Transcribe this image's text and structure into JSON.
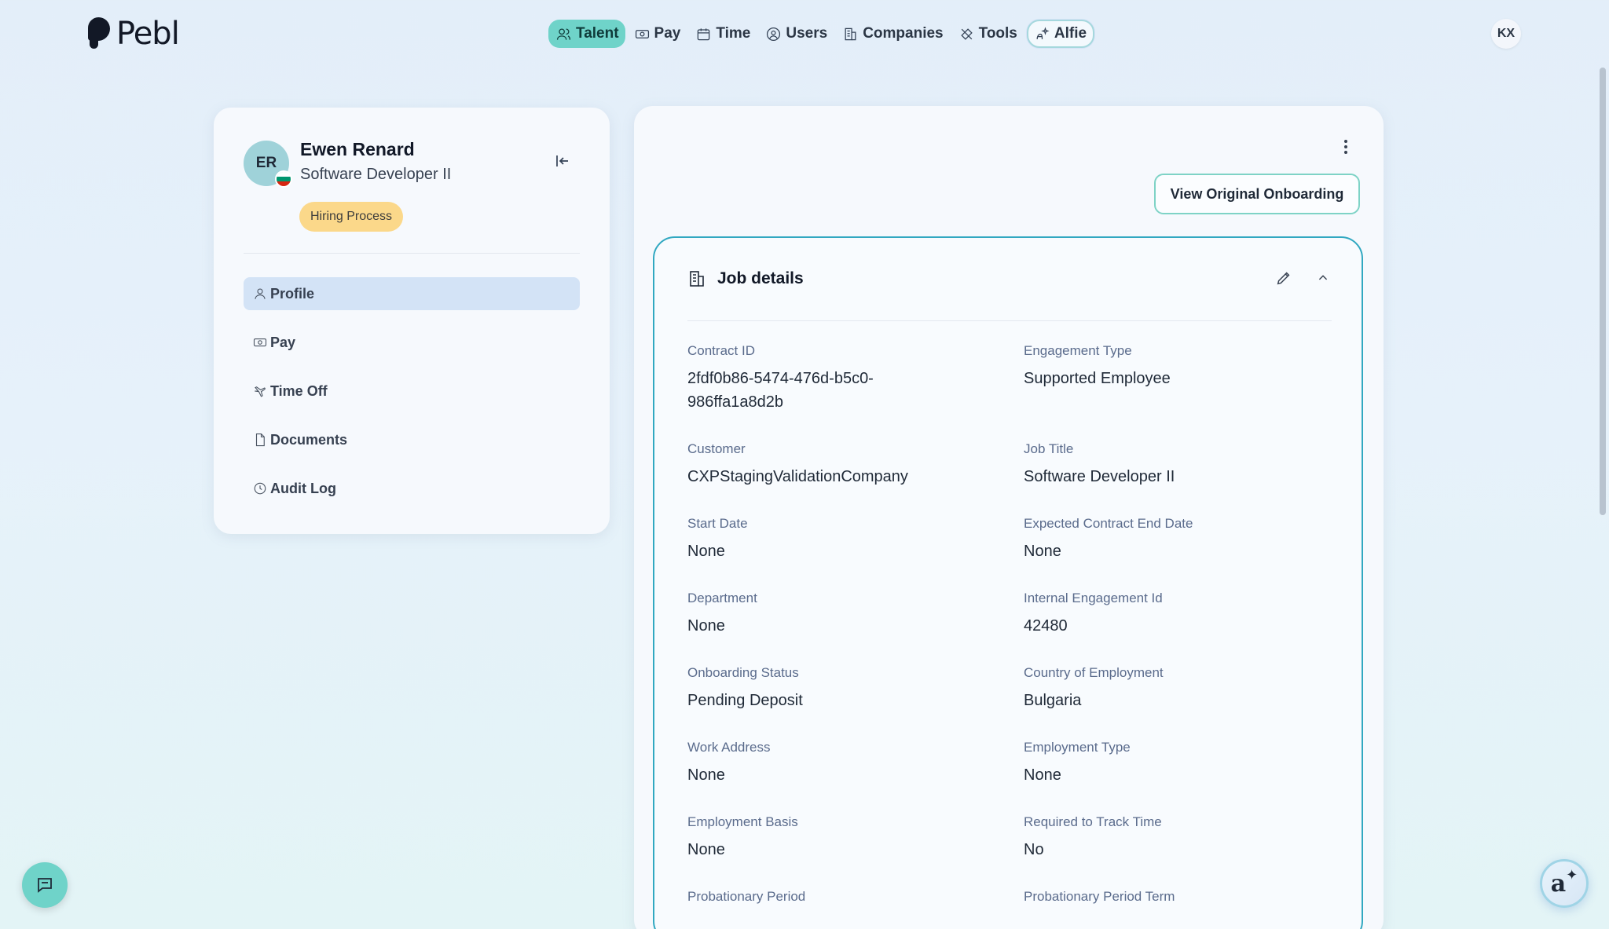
{
  "brand": {
    "name": "Pebl"
  },
  "nav": {
    "items": [
      {
        "label": "Talent",
        "icon": "users-icon",
        "active": true
      },
      {
        "label": "Pay",
        "icon": "money-icon"
      },
      {
        "label": "Time",
        "icon": "calendar-icon"
      },
      {
        "label": "Users",
        "icon": "user-circle-icon"
      },
      {
        "label": "Companies",
        "icon": "building-icon"
      },
      {
        "label": "Tools",
        "icon": "tools-icon"
      },
      {
        "label": "Alfie",
        "icon": "alfie-icon"
      }
    ]
  },
  "user": {
    "initials": "KX"
  },
  "profile": {
    "initials": "ER",
    "name": "Ewen Renard",
    "title": "Software Developer II",
    "badge": "Hiring Process",
    "flag": "bulgaria-flag-icon",
    "menu": [
      {
        "label": "Profile",
        "icon": "person-icon",
        "active": true
      },
      {
        "label": "Pay",
        "icon": "money-icon"
      },
      {
        "label": "Time Off",
        "icon": "plane-icon"
      },
      {
        "label": "Documents",
        "icon": "document-icon"
      },
      {
        "label": "Audit Log",
        "icon": "clock-icon"
      }
    ]
  },
  "main": {
    "view_button": "View Original Onboarding",
    "job_details": {
      "title": "Job details",
      "fields": [
        {
          "label": "Contract ID",
          "value": "2fdf0b86-5474-476d-b5c0-\n986ffa1a8d2b"
        },
        {
          "label": "Engagement Type",
          "value": "Supported Employee"
        },
        {
          "label": "Customer",
          "value": "CXPStagingValidationCompany"
        },
        {
          "label": "Job Title",
          "value": "Software Developer II"
        },
        {
          "label": "Start Date",
          "value": "None"
        },
        {
          "label": "Expected Contract End Date",
          "value": "None"
        },
        {
          "label": "Department",
          "value": "None"
        },
        {
          "label": "Internal Engagement Id",
          "value": "42480"
        },
        {
          "label": "Onboarding Status",
          "value": "Pending Deposit"
        },
        {
          "label": "Country of Employment",
          "value": "Bulgaria"
        },
        {
          "label": "Work Address",
          "value": "None"
        },
        {
          "label": "Employment Type",
          "value": "None"
        },
        {
          "label": "Employment Basis",
          "value": "None"
        },
        {
          "label": "Required to Track Time",
          "value": "No"
        },
        {
          "label": "Probationary Period",
          "value": ""
        },
        {
          "label": "Probationary Period Term",
          "value": ""
        }
      ]
    }
  },
  "colors": {
    "accent": "#6fd3c9",
    "card_border": "#31a8c1",
    "badge": "#fbd88a"
  }
}
